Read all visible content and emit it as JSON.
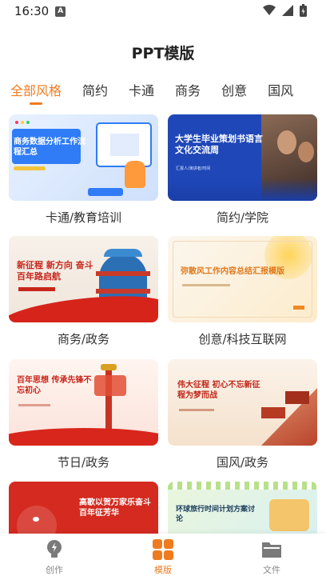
{
  "status": {
    "time": "16:30",
    "notification_badge": "A"
  },
  "header": {
    "title": "PPT模版"
  },
  "tabs": [
    {
      "label": "全部风格",
      "active": true
    },
    {
      "label": "简约",
      "active": false
    },
    {
      "label": "卡通",
      "active": false
    },
    {
      "label": "商务",
      "active": false
    },
    {
      "label": "创意",
      "active": false
    },
    {
      "label": "国风",
      "active": false
    }
  ],
  "cards": [
    {
      "label": "卡通/教育培训",
      "thumb_title": "商务数据分析工作流程汇总",
      "thumb_sub": ""
    },
    {
      "label": "简约/学院",
      "thumb_title": "大学生毕业策划书语言文化交流周",
      "thumb_sub": "汇报人/演讲者/时间"
    },
    {
      "label": "商务/政务",
      "thumb_title": "新征程 新方向 奋斗百年路启航",
      "thumb_sub": ""
    },
    {
      "label": "创意/科技互联网",
      "thumb_title": "弥散风工作内容总结汇报模版",
      "thumb_sub": ""
    },
    {
      "label": "节日/政务",
      "thumb_title": "百年思想 传承先锋不忘初心",
      "thumb_sub": ""
    },
    {
      "label": "国风/政务",
      "thumb_title": "伟大征程 初心不忘新征程为梦而战",
      "thumb_sub": ""
    },
    {
      "label": "",
      "thumb_title": "高歌以贺万家乐奋斗百年征芳华",
      "thumb_sub": ""
    },
    {
      "label": "",
      "thumb_title": "环球旅行时间计划方案讨论",
      "thumb_sub": ""
    }
  ],
  "bottom_nav": [
    {
      "label": "创作",
      "icon": "bulb-icon",
      "active": false
    },
    {
      "label": "模版",
      "icon": "grid-icon",
      "active": true
    },
    {
      "label": "文件",
      "icon": "folder-icon",
      "active": false
    }
  ],
  "colors": {
    "accent": "#f07b1f"
  }
}
